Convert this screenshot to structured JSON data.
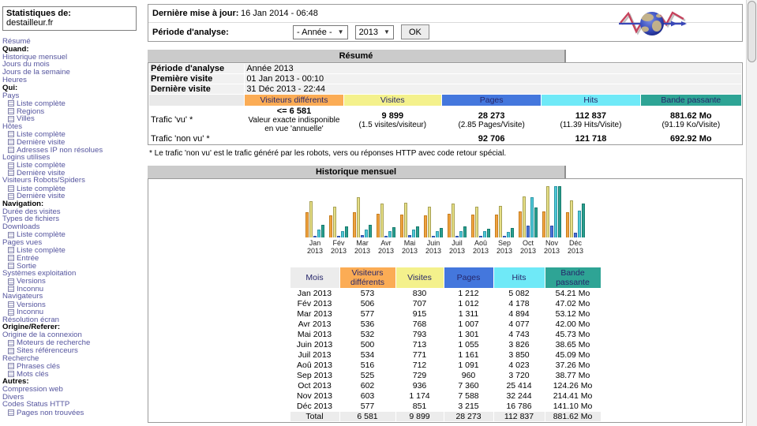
{
  "colors": {
    "link": "#55559E",
    "title_bar_bg": "#CBCBCB",
    "header_text": "#26266A",
    "gray_cell": "#ECECEC",
    "series": [
      {
        "name": "Visiteurs différents",
        "header": "#FBAC55",
        "bar": "#EFA33F",
        "border": "#C77E1F"
      },
      {
        "name": "Visites",
        "header": "#F4F18C",
        "bar": "#E6DF86",
        "border": "#A8A256"
      },
      {
        "name": "Pages",
        "header": "#4477DD",
        "bar": "#4B72D9",
        "border": "#2B4FA5"
      },
      {
        "name": "Hits",
        "header": "#6FE9F7",
        "bar": "#4FC8D6",
        "border": "#2D97A8"
      },
      {
        "name": "Bande passante",
        "header": "#2EA495",
        "bar": "#2AA091",
        "border": "#177A6C"
      }
    ]
  },
  "sidebar": {
    "title": "Statistiques de:",
    "site": "destailleur.fr",
    "items": [
      {
        "t": "l",
        "label": "Résumé"
      },
      {
        "t": "h",
        "label": "Quand:"
      },
      {
        "t": "l",
        "label": "Historique mensuel"
      },
      {
        "t": "l",
        "label": "Jours du mois"
      },
      {
        "t": "l",
        "label": "Jours de la semaine"
      },
      {
        "t": "l",
        "label": "Heures"
      },
      {
        "t": "h",
        "label": "Qui:"
      },
      {
        "t": "l",
        "label": "Pays"
      },
      {
        "t": "s",
        "label": "Liste complète"
      },
      {
        "t": "s",
        "label": "Regions"
      },
      {
        "t": "s",
        "label": "Villes"
      },
      {
        "t": "l",
        "label": "Hôtes"
      },
      {
        "t": "s",
        "label": "Liste complète"
      },
      {
        "t": "s",
        "label": "Dernière visite"
      },
      {
        "t": "s",
        "label": "Adresses IP non résolues"
      },
      {
        "t": "l",
        "label": "Logins utilises"
      },
      {
        "t": "s",
        "label": "Liste complète"
      },
      {
        "t": "s",
        "label": "Dernière visite"
      },
      {
        "t": "l",
        "label": "Visiteurs Robots/Spiders"
      },
      {
        "t": "s",
        "label": "Liste complète"
      },
      {
        "t": "s",
        "label": "Dernière visite"
      },
      {
        "t": "h",
        "label": "Navigation:"
      },
      {
        "t": "l",
        "label": "Durée des visites"
      },
      {
        "t": "l",
        "label": "Types de fichiers"
      },
      {
        "t": "l",
        "label": "Downloads"
      },
      {
        "t": "s",
        "label": "Liste complète"
      },
      {
        "t": "l",
        "label": "Pages vues"
      },
      {
        "t": "s",
        "label": "Liste complète"
      },
      {
        "t": "s",
        "label": "Entrée"
      },
      {
        "t": "s",
        "label": "Sortie"
      },
      {
        "t": "l",
        "label": "Systèmes exploitation"
      },
      {
        "t": "s",
        "label": "Versions"
      },
      {
        "t": "s",
        "label": "Inconnu"
      },
      {
        "t": "l",
        "label": "Navigateurs"
      },
      {
        "t": "s",
        "label": "Versions"
      },
      {
        "t": "s",
        "label": "Inconnu"
      },
      {
        "t": "l",
        "label": "Résolution écran"
      },
      {
        "t": "h",
        "label": "Origine/Referer:"
      },
      {
        "t": "l",
        "label": "Origine de la connexion"
      },
      {
        "t": "s",
        "label": "Moteurs de recherche"
      },
      {
        "t": "s",
        "label": "Sites référenceurs"
      },
      {
        "t": "l",
        "label": "Recherche"
      },
      {
        "t": "s",
        "label": "Phrases clés"
      },
      {
        "t": "s",
        "label": "Mots clés"
      },
      {
        "t": "h",
        "label": "Autres:"
      },
      {
        "t": "l",
        "label": "Compression web"
      },
      {
        "t": "l",
        "label": "Divers"
      },
      {
        "t": "l",
        "label": "Codes Status HTTP"
      },
      {
        "t": "s",
        "label": "Pages non trouvées"
      }
    ]
  },
  "topbar": {
    "last_update_label": "Dernière mise à jour:",
    "last_update_value": "16 Jan 2014 - 06:48",
    "period_label": "Période d'analyse:",
    "period_select": "- Année -",
    "year_select": "2013",
    "ok_label": "OK"
  },
  "summary": {
    "title": "Résumé",
    "info_rows": [
      {
        "label": "Période d'analyse",
        "value": "Année 2013"
      },
      {
        "label": "Première visite",
        "value": "01 Jan 2013 - 00:10"
      },
      {
        "label": "Dernière visite",
        "value": "31 Déc 2013 - 22:44"
      }
    ],
    "columns": [
      "Visiteurs différents",
      "Visites",
      "Pages",
      "Hits",
      "Bande passante"
    ],
    "rows": [
      {
        "label": "Trafic 'vu' *",
        "cells": [
          {
            "main": "<= 6 581",
            "sub": "Valeur exacte indisponible en vue 'annuelle'"
          },
          {
            "main": "9 899",
            "sub": "(1.5 visites/visiteur)"
          },
          {
            "main": "28 273",
            "sub": "(2.85 Pages/Visite)"
          },
          {
            "main": "112 837",
            "sub": "(11.39 Hits/Visite)"
          },
          {
            "main": "881.62 Mo",
            "sub": "(91.19 Ko/Visite)"
          }
        ]
      },
      {
        "label": "Trafic 'non vu' *",
        "cells": [
          {
            "main": "",
            "sub": ""
          },
          {
            "main": "",
            "sub": ""
          },
          {
            "main": "92 706",
            "sub": ""
          },
          {
            "main": "121 718",
            "sub": ""
          },
          {
            "main": "692.92 Mo",
            "sub": ""
          }
        ]
      }
    ],
    "footnote": "* Le trafic 'non vu' est le trafic généré par les robots, vers ou réponses HTTP avec code retour spécial."
  },
  "monthly": {
    "title": "Historique mensuel",
    "chart_data": {
      "type": "bar",
      "title": "Historique mensuel",
      "categories": [
        "Jan 2013",
        "Fév 2013",
        "Mar 2013",
        "Avr 2013",
        "Mai 2013",
        "Juin 2013",
        "Juil 2013",
        "Aoû 2013",
        "Sep 2013",
        "Oct 2013",
        "Nov 2013",
        "Déc 2013"
      ],
      "series": [
        {
          "name": "Visiteurs différents",
          "scale_group": "visits",
          "values": [
            573,
            506,
            577,
            536,
            532,
            500,
            534,
            516,
            525,
            602,
            603,
            577
          ]
        },
        {
          "name": "Visites",
          "scale_group": "visits",
          "values": [
            830,
            707,
            915,
            768,
            793,
            713,
            771,
            712,
            729,
            936,
            1174,
            851
          ]
        },
        {
          "name": "Pages",
          "scale_group": "hits",
          "values": [
            1212,
            1012,
            1311,
            1007,
            1301,
            1055,
            1161,
            1091,
            960,
            7360,
            7588,
            3215
          ]
        },
        {
          "name": "Hits",
          "scale_group": "hits",
          "values": [
            5082,
            4178,
            4894,
            4077,
            4743,
            3826,
            3850,
            4023,
            3720,
            25414,
            32244,
            16786
          ]
        },
        {
          "name": "Bande passante (Mo)",
          "scale_group": "bandwidth",
          "values": [
            54.21,
            47.02,
            53.12,
            42.0,
            45.73,
            38.65,
            45.09,
            37.26,
            38.77,
            124.26,
            214.41,
            141.1
          ]
        }
      ],
      "legend_position": "none",
      "grid": false
    },
    "table": {
      "columns": [
        "Mois",
        "Visiteurs différents",
        "Visites",
        "Pages",
        "Hits",
        "Bande passante"
      ],
      "rows": [
        [
          "Jan 2013",
          "573",
          "830",
          "1 212",
          "5 082",
          "54.21 Mo"
        ],
        [
          "Fév 2013",
          "506",
          "707",
          "1 012",
          "4 178",
          "47.02 Mo"
        ],
        [
          "Mar 2013",
          "577",
          "915",
          "1 311",
          "4 894",
          "53.12 Mo"
        ],
        [
          "Avr 2013",
          "536",
          "768",
          "1 007",
          "4 077",
          "42.00 Mo"
        ],
        [
          "Mai 2013",
          "532",
          "793",
          "1 301",
          "4 743",
          "45.73 Mo"
        ],
        [
          "Juin 2013",
          "500",
          "713",
          "1 055",
          "3 826",
          "38.65 Mo"
        ],
        [
          "Juil 2013",
          "534",
          "771",
          "1 161",
          "3 850",
          "45.09 Mo"
        ],
        [
          "Aoû 2013",
          "516",
          "712",
          "1 091",
          "4 023",
          "37.26 Mo"
        ],
        [
          "Sep 2013",
          "525",
          "729",
          "960",
          "3 720",
          "38.77 Mo"
        ],
        [
          "Oct 2013",
          "602",
          "936",
          "7 360",
          "25 414",
          "124.26 Mo"
        ],
        [
          "Nov 2013",
          "603",
          "1 174",
          "7 588",
          "32 244",
          "214.41 Mo"
        ],
        [
          "Déc 2013",
          "577",
          "851",
          "3 215",
          "16 786",
          "141.10 Mo"
        ]
      ],
      "total": [
        "Total",
        "6 581",
        "9 899",
        "28 273",
        "112 837",
        "881.62 Mo"
      ]
    }
  }
}
